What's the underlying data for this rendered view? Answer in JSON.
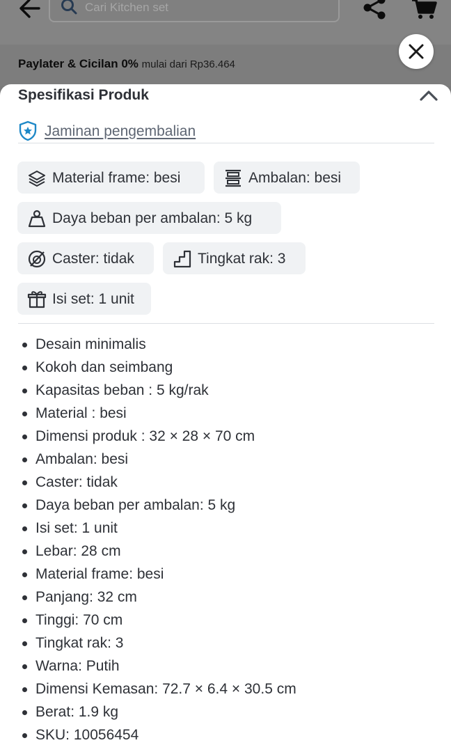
{
  "header": {
    "search_placeholder": "Cari Kitchen set",
    "icons": {
      "back": "arrow-left-icon",
      "search": "search-icon",
      "share": "share-icon",
      "cart": "cart-icon"
    }
  },
  "paylater": {
    "title": "Paylater & Cicilan 0%",
    "subtitle": "mulai dari Rp36.464"
  },
  "close_icon": "close-icon",
  "sheet": {
    "title": "Spesifikasi Produk",
    "collapse_icon": "chevron-up-icon",
    "guarantee": {
      "icon": "shield-star-icon",
      "label": "Jaminan pengembalian"
    },
    "chips": [
      {
        "icon": "layers-icon",
        "label": "Material frame: besi"
      },
      {
        "icon": "shelf-icon",
        "label": "Ambalan: besi"
      },
      {
        "icon": "weight-icon",
        "label": "Daya beban per ambalan: 5 kg"
      },
      {
        "icon": "no-caster-icon",
        "label": "Caster: tidak"
      },
      {
        "icon": "stairs-icon",
        "label": "Tingkat rak: 3"
      },
      {
        "icon": "box-icon",
        "label": "Isi set: 1 unit"
      }
    ],
    "specs": [
      "Desain minimalis",
      "Kokoh dan seimbang",
      "Kapasitas beban : 5 kg/rak",
      "Material : besi",
      "Dimensi produk : 32 × 28 × 70 cm",
      "Ambalan: besi",
      "Caster: tidak",
      "Daya beban per ambalan: 5 kg",
      "Isi set: 1 unit",
      "Lebar: 28 cm",
      "Material frame: besi",
      "Panjang: 32 cm",
      "Tinggi: 70 cm",
      "Tingkat rak: 3",
      "Warna: Putih",
      "Dimensi Kemasan: 72.7 × 6.4 × 30.5 cm",
      "Berat: 1.9 kg",
      "SKU: 10056454"
    ]
  },
  "colors": {
    "overlay": "#7a7a7a",
    "text": "#2e3137",
    "chip_bg": "#f0f2f4",
    "accent": "#1e88c7"
  }
}
